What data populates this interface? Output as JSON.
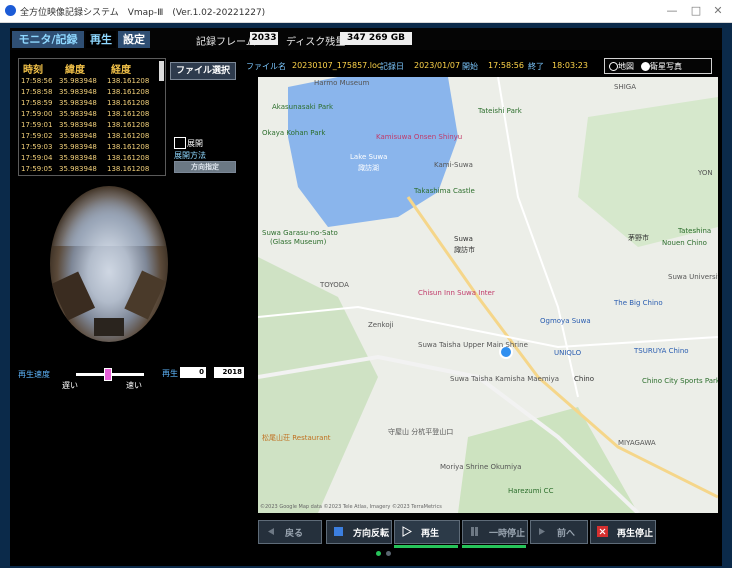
{
  "window": {
    "title": "全方位映像記録システム　Vmap-Ⅲ　(Ver.1.02-20221227)",
    "min_glyph": "—",
    "max_glyph": "□",
    "close_glyph": "✕"
  },
  "modes": {
    "monitor": "モニタ/記録",
    "play": "再生",
    "settings": "設定"
  },
  "stats": {
    "frames_label": "記録フレーム",
    "frames_value": "2033",
    "disk_label": "ディスク残量",
    "disk_value": "347 269 GB"
  },
  "gps_table": {
    "headers": [
      "時刻",
      "緯度",
      "経度"
    ],
    "rows": [
      [
        "17:58:56",
        "35.983948",
        "138.161208"
      ],
      [
        "17:58:58",
        "35.983948",
        "138.161208"
      ],
      [
        "17:58:59",
        "35.983948",
        "138.161208"
      ],
      [
        "17:59:00",
        "35.983948",
        "138.161208"
      ],
      [
        "17:59:01",
        "35.983948",
        "138.161208"
      ],
      [
        "17:59:02",
        "35.983948",
        "138.161208"
      ],
      [
        "17:59:03",
        "35.983948",
        "138.161208"
      ],
      [
        "17:59:04",
        "35.983948",
        "138.161208"
      ],
      [
        "17:59:05",
        "35.983948",
        "138.161208"
      ]
    ]
  },
  "file_select": "ファイル選択",
  "expand": {
    "checkbox_label": "展開",
    "method_label": "展開方法",
    "direction_button": "方向指定"
  },
  "playback_speed": {
    "label": "再生速度",
    "slow": "遅い",
    "fast": "速い",
    "level": 0.45
  },
  "frame_position": {
    "label": "再生",
    "current": "0",
    "total": "2018"
  },
  "file_info": {
    "filename_label": "ファイル名",
    "filename": "20230107_175857.loc",
    "date_label": "記録日",
    "date": "2023/01/07",
    "start_label": "開始",
    "start": "17:58:56",
    "end_label": "終了",
    "end": "18:03:23"
  },
  "map_type": {
    "map": "地図",
    "satellite": "衛星写真",
    "selected": "satellite"
  },
  "map": {
    "labels": {
      "harmo": "Harmo Museum",
      "akasunasaki": "Akasunasaki Park",
      "okaya": "Okaya Kohan Park",
      "tateishi": "Tateishi Park",
      "kamisuwa_onsen": "Kamisuwa Onsen Shinyu",
      "lake": "Lake Suwa",
      "lake_jp": "諏訪湖",
      "kamisuwa": "Kami-Suwa",
      "takashima": "Takashima Castle",
      "garasu": "Suwa Garasu-no-Sato",
      "glass": "(Glass Museum)",
      "suwa": "Suwa",
      "suwa_jp": "諏訪市",
      "toyoda": "TOYODA",
      "chisun": "Chisun Inn Suwa Inter",
      "zenkoji": "Zenkoji",
      "ogmoya": "Ogmoya Suwa",
      "taisha_upper": "Suwa Taisha Upper Main Shrine",
      "uniqlo": "UNIQLO",
      "tsuruya": "TSURUYA Chino",
      "big_chino": "The Big Chino",
      "taisha_maemiya": "Suwa Taisha Kamisha Maemiya",
      "chino": "Chino",
      "chino_city": "Chino City Sports Park",
      "morishita": "守屋山 分杭平登山口",
      "moriya": "Moriya Shrine Okumiya",
      "harezumi": "Harezumi CC",
      "miyagawa": "MIYAGAWA",
      "tateshina": "Tateshina",
      "shiga": "SHIGA",
      "suwa_univ": "Suwa University of Science",
      "yon": "YON",
      "chino_city_jp": "茅野市",
      "nouen": "Nouen Chino",
      "matsuo": "松尾山荘 Restaurant",
      "copyright": "©2023 Google  Map data ©2023 Tele Atlas, Imagery ©2023 TerraMetrics"
    }
  },
  "controls": {
    "back": "戻る",
    "reverse": "方向反転",
    "play": "再生",
    "pause": "一時停止",
    "next": "前へ",
    "stop": "再生停止"
  },
  "colors": {
    "accent": "#2f8ff0",
    "tab_active": "#8fd8ff",
    "stop_red": "#d63030",
    "progress_green": "#27c35a"
  }
}
